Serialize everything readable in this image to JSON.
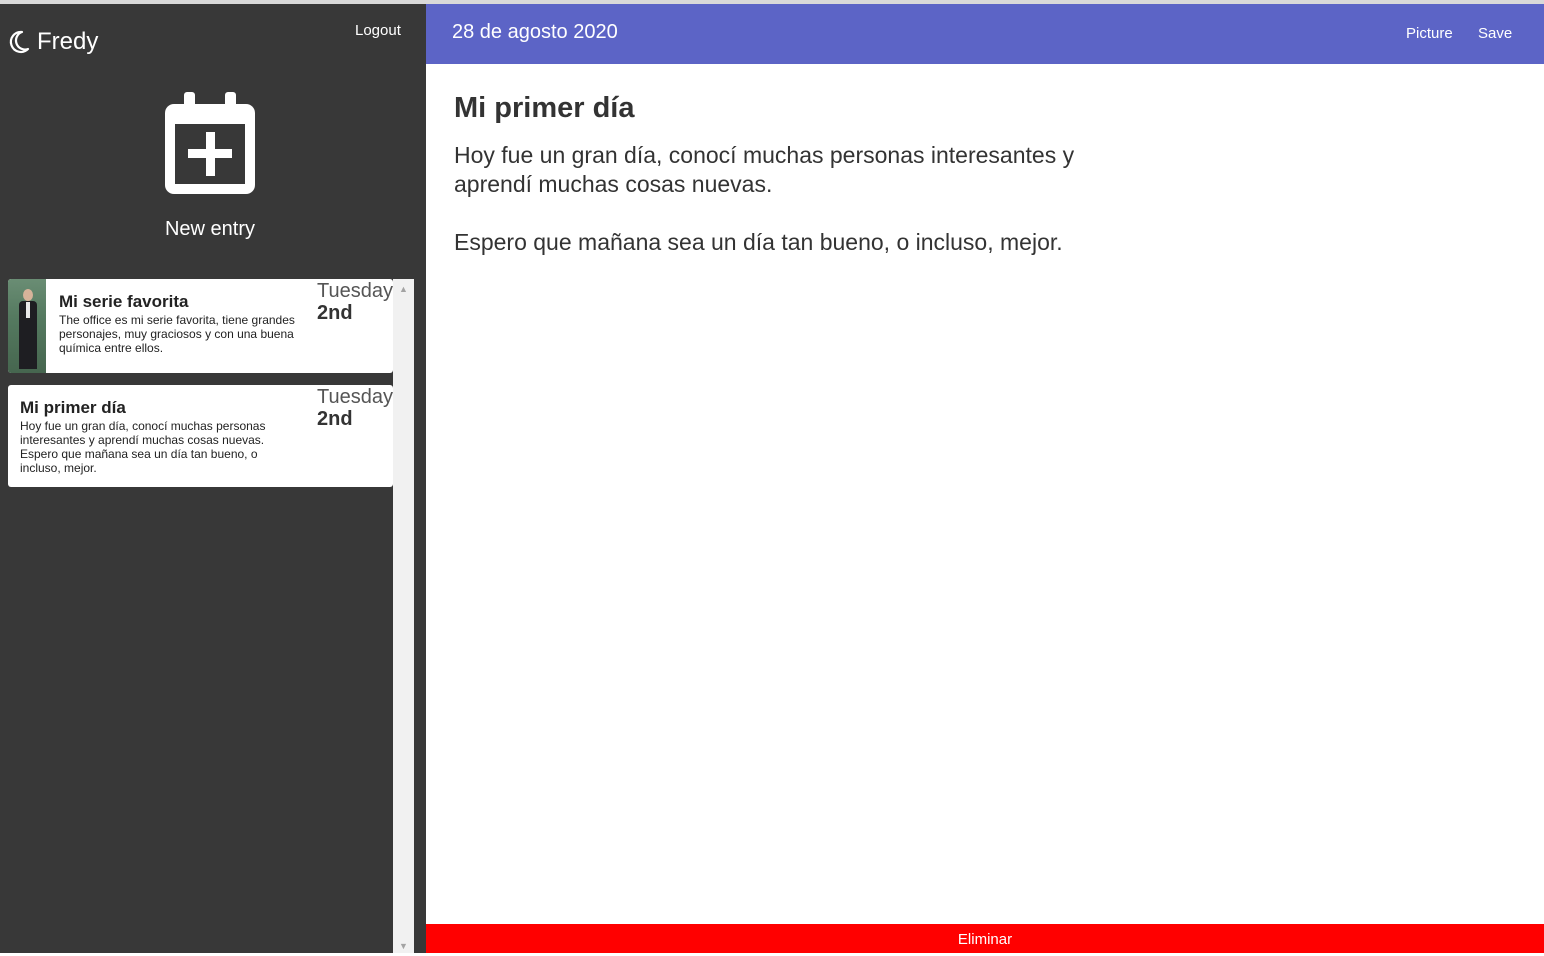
{
  "sidebar": {
    "user_name": "Fredy",
    "logout_label": "Logout",
    "new_entry_label": "New entry",
    "entries": [
      {
        "title": "Mi serie favorita",
        "text": "The office es mi serie favorita, tiene grandes personajes, muy graciosos y con una buena química entre ellos.",
        "day": "Tuesday",
        "date": "2nd",
        "has_image": true
      },
      {
        "title": "Mi primer día",
        "text": "Hoy fue un gran día, conocí muchas personas interesantes y aprendí muchas cosas nuevas. Espero que mañana sea un día tan bueno, o incluso, mejor.",
        "day": "Tuesday",
        "date": "2nd",
        "has_image": false
      }
    ]
  },
  "header": {
    "date": "28 de agosto 2020",
    "picture_label": "Picture",
    "save_label": "Save"
  },
  "editor": {
    "title": "Mi primer día",
    "paragraphs": [
      "Hoy fue un gran día, conocí muchas personas interesantes y aprendí muchas cosas nuevas.",
      "Espero que mañana sea un día tan bueno, o incluso, mejor."
    ]
  },
  "footer": {
    "delete_label": "Eliminar"
  },
  "colors": {
    "sidebar_bg": "#383838",
    "header_bg": "#5c64c6",
    "delete_bg": "#ff0000"
  },
  "icons": {
    "user": "moon-icon",
    "new_entry": "calendar-plus-icon",
    "scroll_up": "arrow-up-icon",
    "scroll_down": "arrow-down-icon"
  }
}
